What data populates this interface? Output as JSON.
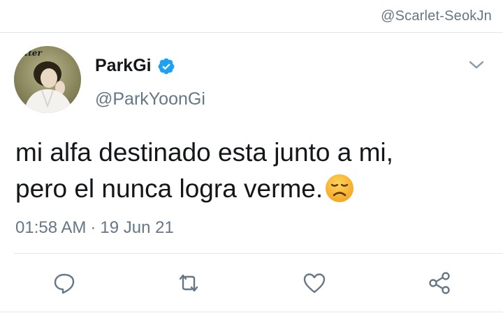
{
  "watermark": "@Scarlet-SeokJn",
  "tweet": {
    "user": {
      "display_name": "ParkGi",
      "handle": "@ParkYoonGi",
      "verified": true,
      "avatar_label": "utter"
    },
    "text_lines": [
      "mi alfa destinado esta junto a mi,",
      "pero el nunca logra verme."
    ],
    "emoji": "disappointed-face",
    "time": "01:58 AM",
    "separator": "·",
    "date": "19 Jun 21"
  },
  "actions": [
    "reply-icon",
    "retweet-icon",
    "like-icon",
    "share-icon"
  ],
  "colors": {
    "text": "#14171a",
    "secondary": "#657786",
    "verified": "#1da1f2",
    "divider": "#e1e8ed",
    "emoji_face": "#f5a623"
  }
}
